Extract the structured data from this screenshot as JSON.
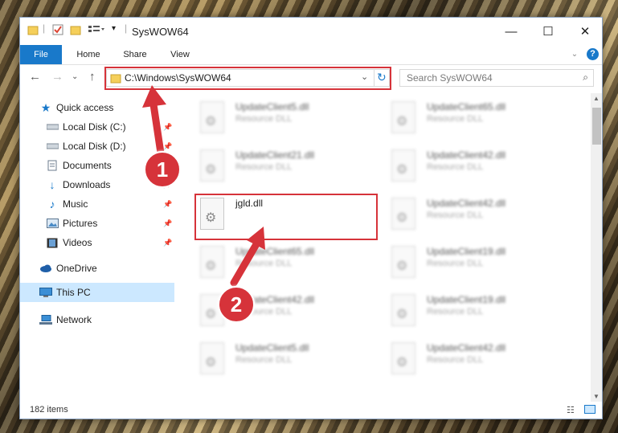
{
  "window": {
    "title": "SysWOW64"
  },
  "ribbon": {
    "tabs": [
      "File",
      "Home",
      "Share",
      "View"
    ]
  },
  "address": {
    "path": "C:\\Windows\\SysWOW64",
    "search_placeholder": "Search SysWOW64"
  },
  "nav": [
    {
      "label": "Quick access",
      "icon": "star-icon"
    },
    {
      "label": "Local Disk (C:)",
      "icon": "drive-icon",
      "pinned": true
    },
    {
      "label": "Local Disk (D:)",
      "icon": "drive-icon",
      "pinned": true
    },
    {
      "label": "Documents",
      "icon": "documents-icon",
      "pinned": true
    },
    {
      "label": "Downloads",
      "icon": "download-icon",
      "pinned": true
    },
    {
      "label": "Music",
      "icon": "music-icon",
      "pinned": true
    },
    {
      "label": "Pictures",
      "icon": "pictures-icon",
      "pinned": true
    },
    {
      "label": "Videos",
      "icon": "videos-icon",
      "pinned": true
    },
    {
      "label": "OneDrive",
      "icon": "cloud-icon"
    },
    {
      "label": "This PC",
      "icon": "computer-icon",
      "selected": true
    },
    {
      "label": "Network",
      "icon": "network-icon"
    }
  ],
  "files": [
    {
      "name": "UpdateClient5.dll",
      "type": "Resource DLL"
    },
    {
      "name": "UpdateClient65.dll",
      "type": "Resource DLL"
    },
    {
      "name": "UpdateClient21.dll",
      "type": "Resource DLL"
    },
    {
      "name": "UpdateClient42.dll",
      "type": "Resource DLL"
    },
    {
      "name": "jgld.dll",
      "type": ""
    },
    {
      "name": "UpdateClient42.dll",
      "type": "Resource DLL"
    },
    {
      "name": "UpdateClient65.dll",
      "type": "Resource DLL"
    },
    {
      "name": "UpdateClient19.dll",
      "type": "Resource DLL"
    },
    {
      "name": "UpdateClient42.dll",
      "type": "Resource DLL"
    },
    {
      "name": "UpdateClient19.dll",
      "type": "Resource DLL"
    },
    {
      "name": "UpdateClient5.dll",
      "type": "Resource DLL"
    },
    {
      "name": "UpdateClient42.dll",
      "type": "Resource DLL"
    }
  ],
  "status": {
    "items": "182 items"
  },
  "annotations": {
    "step1": "1",
    "step2": "2",
    "color": "#d6333a"
  }
}
